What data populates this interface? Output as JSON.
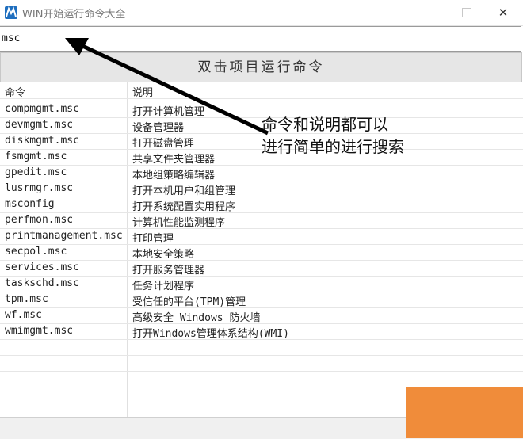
{
  "window": {
    "title": "WIN开始运行命令大全",
    "minimize_glyph": "—",
    "close_glyph": "✕"
  },
  "search": {
    "value": "msc"
  },
  "run_button": {
    "label": "双击项目运行命令"
  },
  "table": {
    "headers": {
      "command": "命令",
      "description": "说明"
    },
    "rows": [
      {
        "command": "compmgmt.msc",
        "description": "打开计算机管理"
      },
      {
        "command": "devmgmt.msc",
        "description": "设备管理器"
      },
      {
        "command": "diskmgmt.msc",
        "description": "打开磁盘管理"
      },
      {
        "command": "fsmgmt.msc",
        "description": "共享文件夹管理器"
      },
      {
        "command": "gpedit.msc",
        "description": "本地组策略编辑器"
      },
      {
        "command": "lusrmgr.msc",
        "description": "打开本机用户和组管理"
      },
      {
        "command": "msconfig",
        "description": "打开系统配置实用程序"
      },
      {
        "command": "perfmon.msc",
        "description": "计算机性能监测程序"
      },
      {
        "command": "printmanagement.msc",
        "description": "打印管理"
      },
      {
        "command": "secpol.msc",
        "description": "本地安全策略"
      },
      {
        "command": "services.msc",
        "description": "打开服务管理器"
      },
      {
        "command": "taskschd.msc",
        "description": "任务计划程序"
      },
      {
        "command": "tpm.msc",
        "description": "受信任的平台(TPM)管理"
      },
      {
        "command": "wf.msc",
        "description": "高级安全 Windows 防火墙"
      },
      {
        "command": "wmimgmt.msc",
        "description": "打开Windows管理体系结构(WMI)"
      }
    ]
  },
  "annotation": {
    "line1": "命令和说明都可以",
    "line2": "进行简单的进行搜索"
  },
  "colors": {
    "app_icon": "#1f6fbf",
    "arrow": "#000000",
    "orange_block": "#f08c3a"
  }
}
